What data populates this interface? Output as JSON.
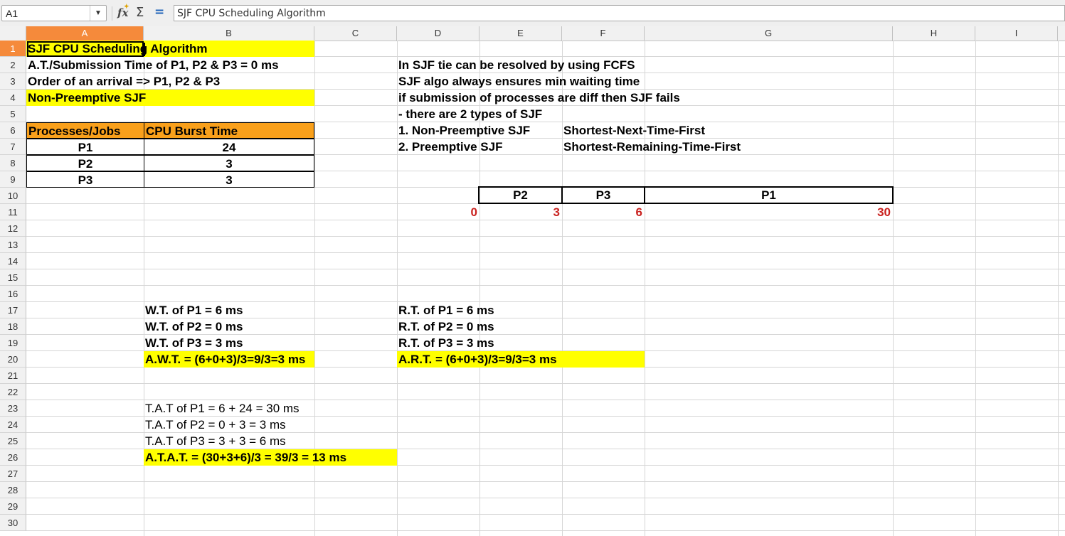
{
  "formula_bar": {
    "name_box": "A1",
    "content": "SJF CPU Scheduling Algorithm",
    "icons": [
      "function-wizard-icon",
      "sum-icon",
      "equals-icon"
    ]
  },
  "columns": [
    "A",
    "B",
    "C",
    "D",
    "E",
    "F",
    "G",
    "H",
    "I"
  ],
  "rows": [
    "1",
    "2",
    "3",
    "4",
    "5",
    "6",
    "7",
    "8",
    "9",
    "10",
    "11",
    "12",
    "13",
    "14",
    "15",
    "16",
    "17",
    "18",
    "19",
    "20",
    "21",
    "22",
    "23",
    "24",
    "25",
    "26",
    "27",
    "28",
    "29",
    "30"
  ],
  "colors": {
    "highlight": "#ffff00",
    "header_fill": "#f9a01b",
    "selection": "#f58a3b",
    "timeline_numbers": "#c9211e"
  },
  "cells": {
    "A1": "SJF CPU Scheduling Algorithm",
    "A2": "A.T./Submission Time of P1, P2 & P3 = 0 ms",
    "A3": "Order of an arrival => P1, P2 & P3",
    "A4": "Non-Preemptive SJF",
    "A6": "Processes/Jobs",
    "B6": "CPU Burst Time",
    "A7": "P1",
    "B7": "24",
    "A8": "P2",
    "B8": "3",
    "A9": "P3",
    "B9": "3",
    "D2": "In SJF tie can be resolved by using FCFS",
    "D3": "SJF algo always ensures min waiting time",
    "D4": "if submission of processes are diff then SJF fails",
    "D5": "- there are 2 types of SJF",
    "D6": "1. Non-Preemptive SJF",
    "F6": "Shortest-Next-Time-First",
    "D7": "2. Preemptive SJF",
    "F7": "Shortest-Remaining-Time-First",
    "E10": "P2",
    "F10": "P3",
    "G10": "P1",
    "D11": "0",
    "E11": "3",
    "F11": "6",
    "G11": "30",
    "B17": "W.T. of P1 = 6 ms",
    "B18": "W.T. of P2 = 0 ms",
    "B19": "W.T. of P3 = 3 ms",
    "B20": "A.W.T. = (6+0+3)/3=9/3=3 ms",
    "D17": "R.T. of P1 = 6 ms",
    "D18": "R.T. of P2 = 0 ms",
    "D19": "R.T. of P3 = 3 ms",
    "D20": "A.R.T. = (6+0+3)/3=9/3=3 ms",
    "B23": "T.A.T of P1 = 6 + 24 = 30 ms",
    "B24": "T.A.T of P2 = 0 + 3 = 3 ms",
    "B25": "T.A.T of P3 = 3 + 3 = 6 ms",
    "B26": "A.T.A.T. = (30+3+6)/3 = 39/3 = 13 ms"
  }
}
